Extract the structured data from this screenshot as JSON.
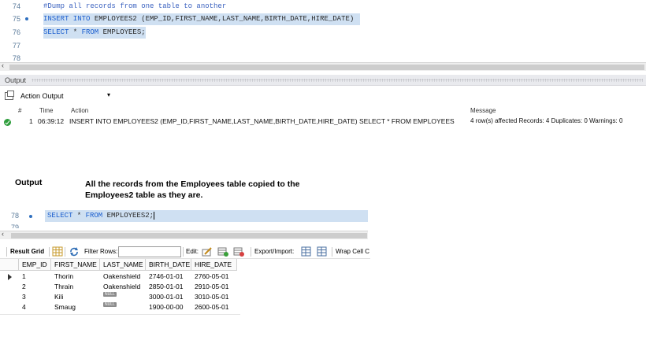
{
  "editor1": {
    "lines": [
      {
        "num": "74",
        "text": "#Dump all records from one table to another"
      },
      {
        "num": "75",
        "kw1": "INSERT INTO",
        "rest": " EMPLOYEES2 (EMP_ID,FIRST_NAME,LAST_NAME,BIRTH_DATE,HIRE_DATE)"
      },
      {
        "num": "76",
        "kw1": "SELECT",
        "mid": " * ",
        "kw2": "FROM",
        "rest": " EMPLOYEES;"
      },
      {
        "num": "77"
      },
      {
        "num": "78"
      }
    ]
  },
  "output_panel": {
    "title": "Output",
    "selector_label": "Action Output",
    "columns": {
      "num": "#",
      "time": "Time",
      "action": "Action",
      "message": "Message"
    },
    "row": {
      "num": "1",
      "time": "06:39:12",
      "action": "INSERT INTO EMPLOYEES2 (EMP_ID,FIRST_NAME,LAST_NAME,BIRTH_DATE,HIRE_DATE) SELECT * FROM EMPLOYEES",
      "message": "4 row(s) affected Records: 4  Duplicates: 0  Warnings: 0"
    }
  },
  "annotation": {
    "title": "Output",
    "text_line1": "All the records from the Employees table copied to the",
    "text_line2": "Employees2 table as they are."
  },
  "editor2": {
    "line_num": "78",
    "next_line_num": "79",
    "kw1": "SELECT",
    "mid": " * ",
    "kw2": "FROM",
    "rest": " EMPLOYEES2;"
  },
  "result_toolbar": {
    "result_grid": "Result Grid",
    "filter_rows": "Filter Rows:",
    "edit": "Edit:",
    "export_import": "Export/Import:",
    "wrap_cell": "Wrap Cell C"
  },
  "result_grid": {
    "columns": [
      "EMP_ID",
      "FIRST_NAME",
      "LAST_NAME",
      "BIRTH_DATE",
      "HIRE_DATE"
    ],
    "rows": [
      [
        "1",
        "Thorin",
        "Oakenshield",
        "2746-01-01",
        "2760-05-01"
      ],
      [
        "2",
        "Thrain",
        "Oakenshield",
        "2850-01-01",
        "2910-05-01"
      ],
      [
        "3",
        "Kili",
        "NULL",
        "3000-01-01",
        "3010-05-01"
      ],
      [
        "4",
        "Smaug",
        "NULL",
        "1900-00-00",
        "2600-05-01"
      ]
    ]
  }
}
